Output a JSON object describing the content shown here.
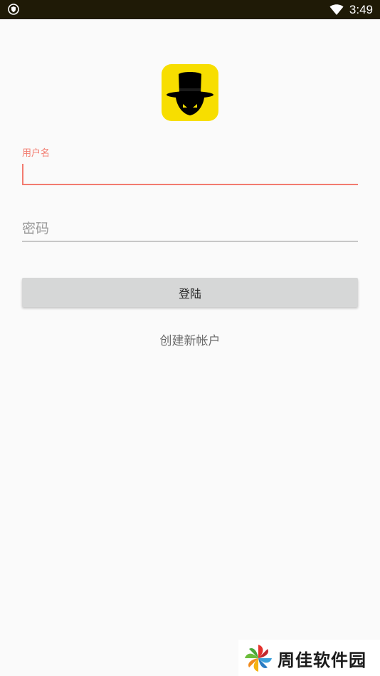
{
  "status_bar": {
    "time": "3:49",
    "left_icon": "vpn-shield-icon",
    "right_icon": "wifi-icon"
  },
  "app": {
    "logo_icon": "top-hat-mascot-icon",
    "logo_bg_color": "#f7de00"
  },
  "login_form": {
    "username": {
      "label": "用户名",
      "value": ""
    },
    "password": {
      "placeholder": "密码",
      "value": ""
    },
    "login_button_label": "登陆",
    "create_account_label": "创建新帐户"
  },
  "colors": {
    "accent": "#f27b6f",
    "background": "#fafafa",
    "button": "#d6d7d7",
    "status_bar": "#1f1a06"
  },
  "watermark": {
    "text": "周佳软件园",
    "icon": "pinwheel-logo-icon"
  }
}
